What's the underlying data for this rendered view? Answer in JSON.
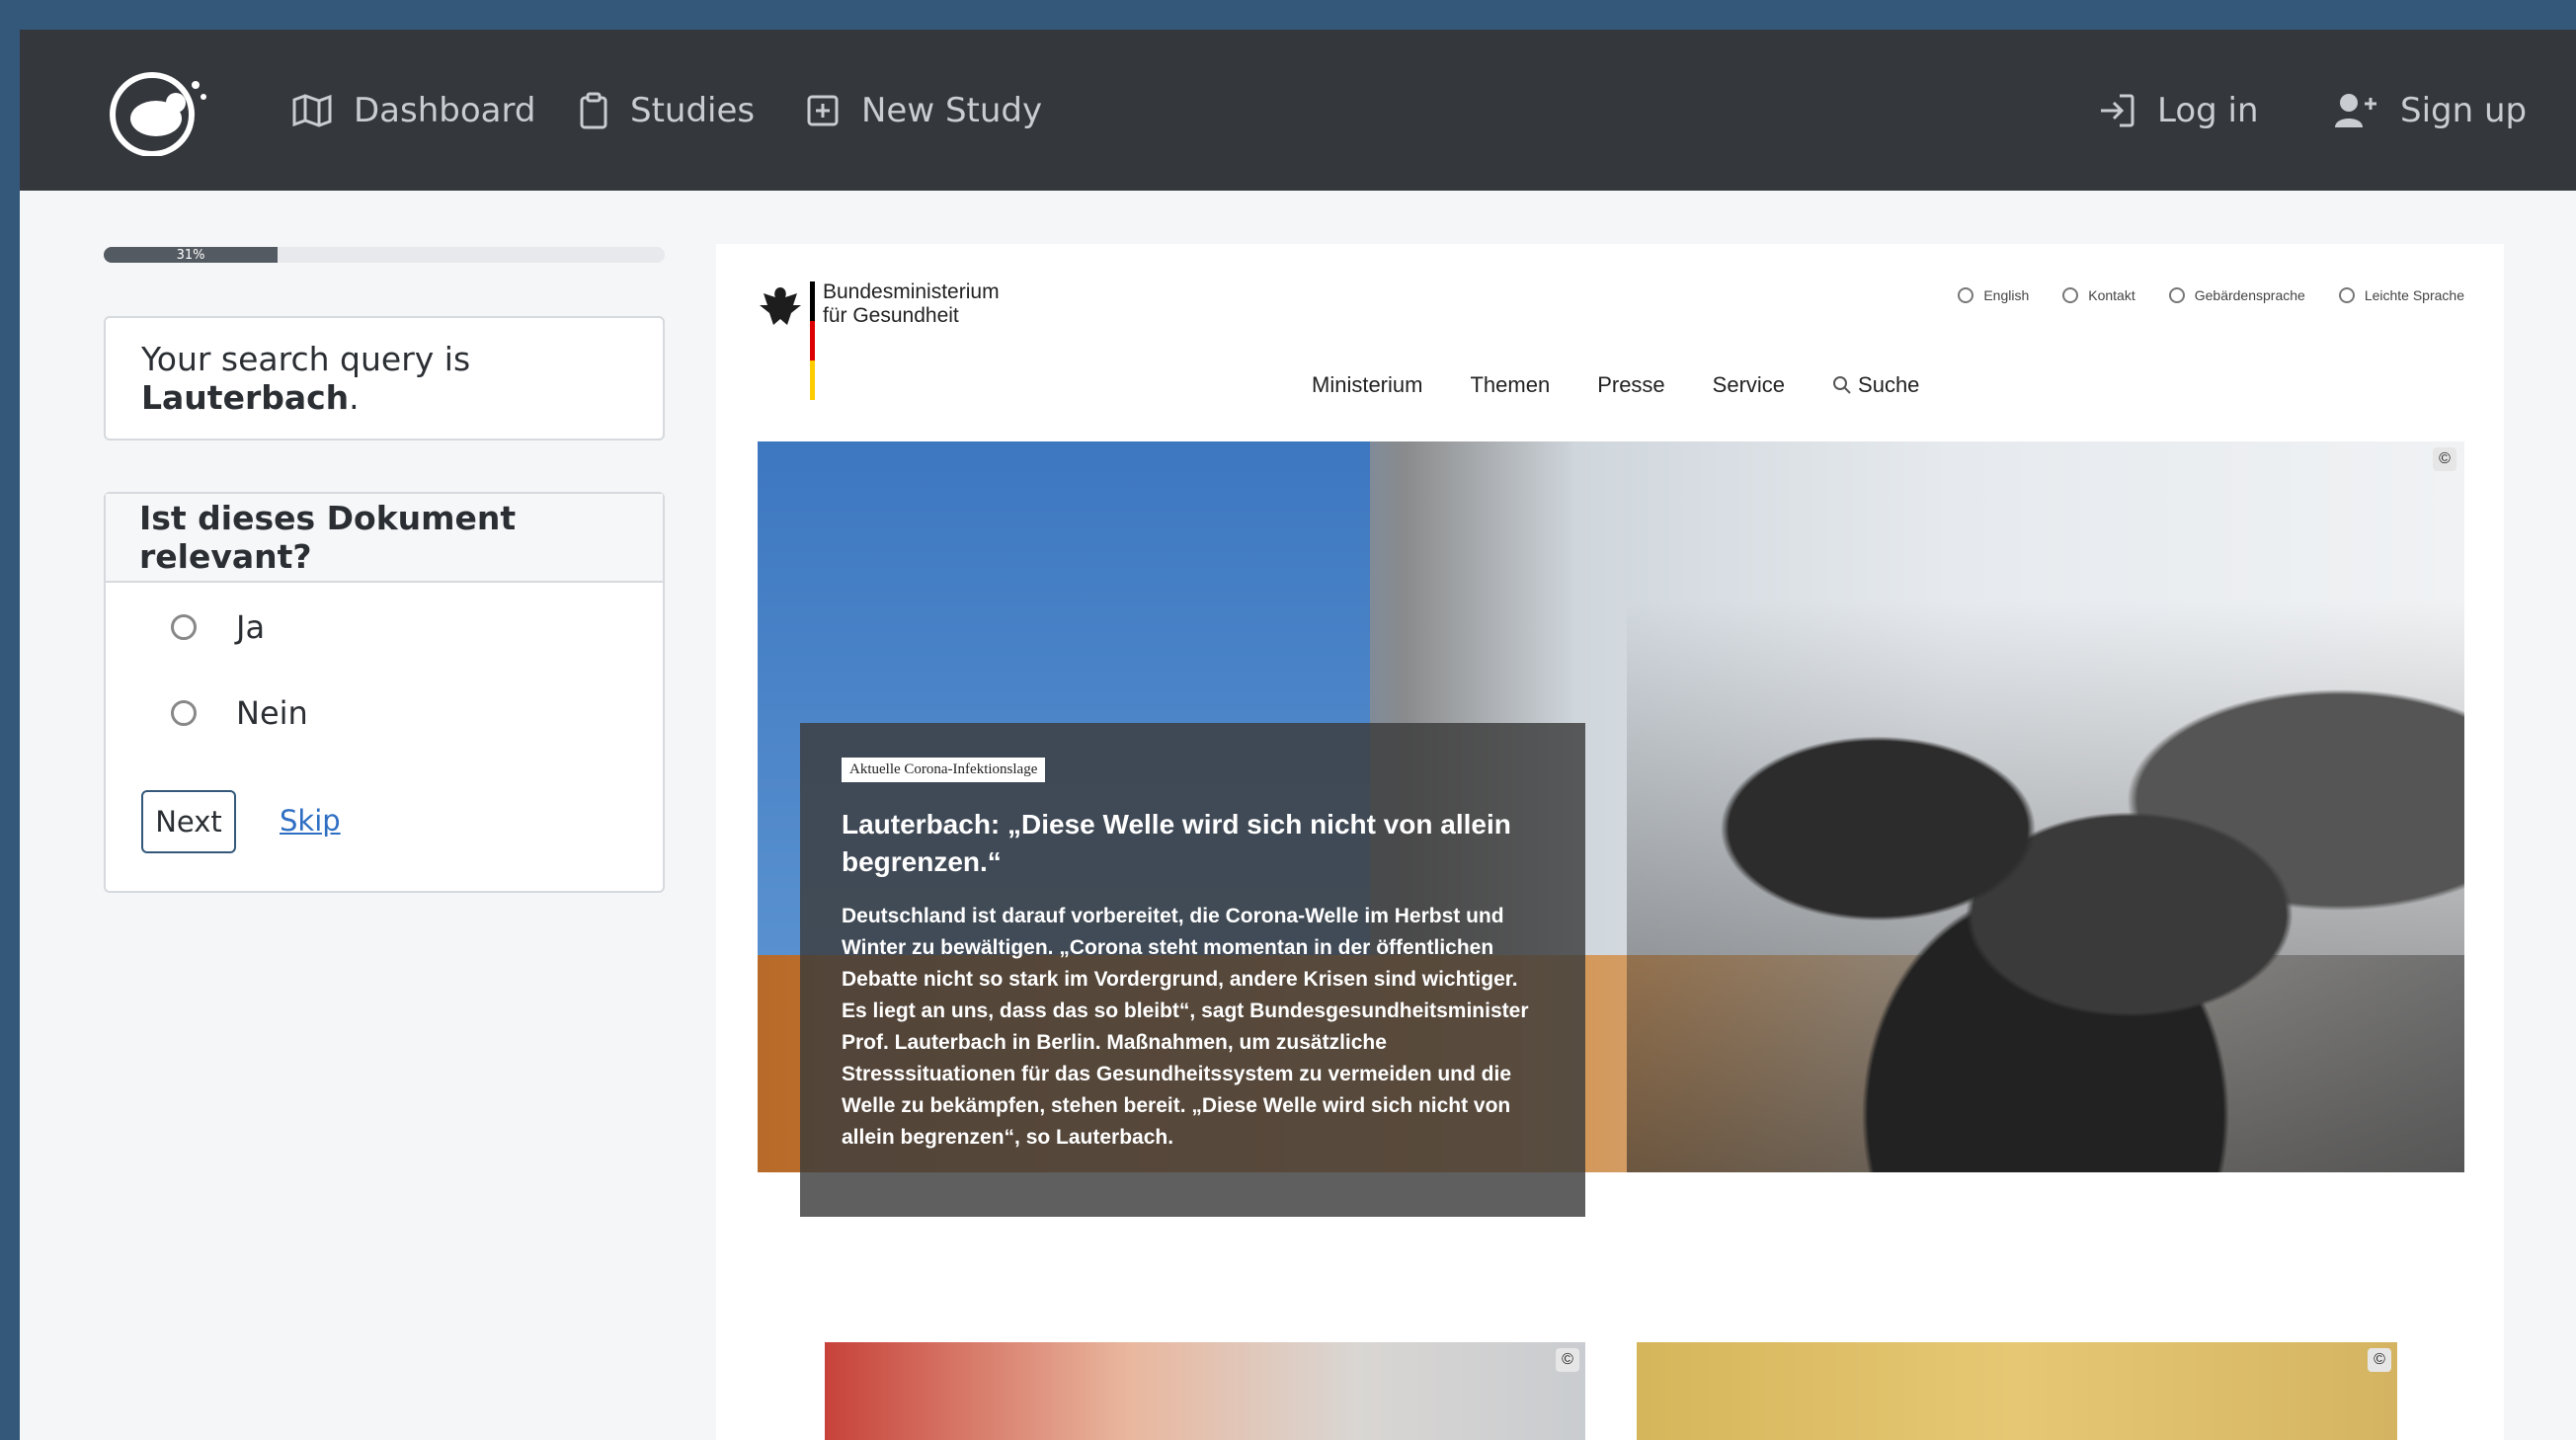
{
  "navbar": {
    "dashboard": "Dashboard",
    "studies": "Studies",
    "new_study": "New Study",
    "login": "Log in",
    "signup": "Sign up"
  },
  "progress": {
    "label": "31%",
    "value": 0.31
  },
  "query": {
    "prefix": "Your search query is ",
    "term": "Lauterbach",
    "suffix": "."
  },
  "question": {
    "title": "Ist dieses Dokument relevant?",
    "options": [
      "Ja",
      "Nein"
    ],
    "next_label": "Next",
    "skip_label": "Skip"
  },
  "document": {
    "org_line1": "Bundesministerium",
    "org_line2": "für Gesundheit",
    "top_links": [
      "English",
      "Kontakt",
      "Gebärdensprache",
      "Leichte Sprache"
    ],
    "menu": [
      "Ministerium",
      "Themen",
      "Presse",
      "Service",
      "Suche"
    ],
    "copyright": "©",
    "teaser": {
      "tag": "Aktuelle Corona-Infektionslage",
      "title": "Lauterbach: „Diese Welle wird sich nicht von allein begrenzen.“",
      "text": "Deutschland ist darauf vorbereitet, die Corona-Welle im Herbst und Winter zu bewältigen. „Corona steht momentan in der öffentlichen Debatte nicht so stark im Vordergrund, andere Krisen sind wichtiger. Es liegt an uns, dass das so bleibt“, sagt Bundesgesundheitsminister Prof. Lauterbach in Berlin. Maßnahmen, um zusätzliche Stresssituationen für das Gesundheitssystem zu vermeiden und die Welle zu bekämpfen, stehen bereit. „Diese Welle wird sich nicht von allein begrenzen“, so Lauterbach."
    }
  }
}
